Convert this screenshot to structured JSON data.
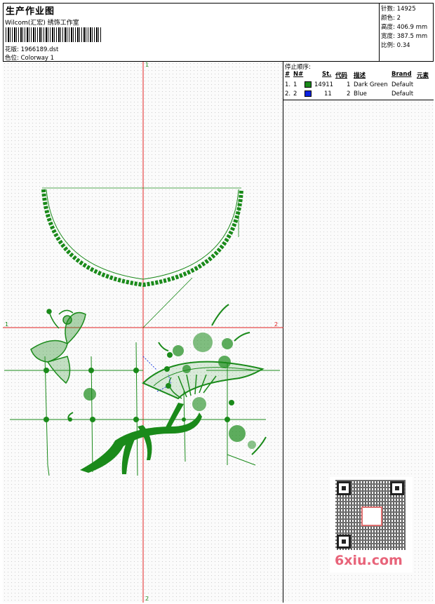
{
  "header": {
    "title": "生产作业图",
    "studio": "Wilcom(汇宏) 绣饰工作室",
    "design_label": "花版:",
    "design_value": "1966189.dst",
    "colorway_label": "色位:",
    "colorway_value": "Colorway 1"
  },
  "stats": [
    {
      "label": "针数:",
      "value": "14925"
    },
    {
      "label": "颜色:",
      "value": "2"
    },
    {
      "label": "高度:",
      "value": "406.9 mm"
    },
    {
      "label": "宽度:",
      "value": "387.5 mm"
    },
    {
      "label": "比例:",
      "value": "0.34"
    }
  ],
  "stop_sequence": {
    "label": "停止顺序:",
    "headers": {
      "num": "#",
      "n": "N#",
      "st": "St.",
      "code": "代码",
      "desc": "描述",
      "brand": "Brand",
      "elem": "元素"
    },
    "rows": [
      {
        "num": "1.",
        "n": "1",
        "color": "#1a8a1a",
        "st": "14911",
        "code": "1",
        "desc": "Dark Green",
        "brand": "Default"
      },
      {
        "num": "2.",
        "n": "2",
        "color": "#0a22e0",
        "st": "11",
        "code": "2",
        "desc": "Blue",
        "brand": "Default"
      }
    ]
  },
  "axis_labels": {
    "top": "1",
    "bottom": "2",
    "left": "1",
    "right": "2"
  },
  "watermark": "6xiu.com",
  "colors": {
    "stitch": "#1a8a1a",
    "axis": "#e02020"
  }
}
